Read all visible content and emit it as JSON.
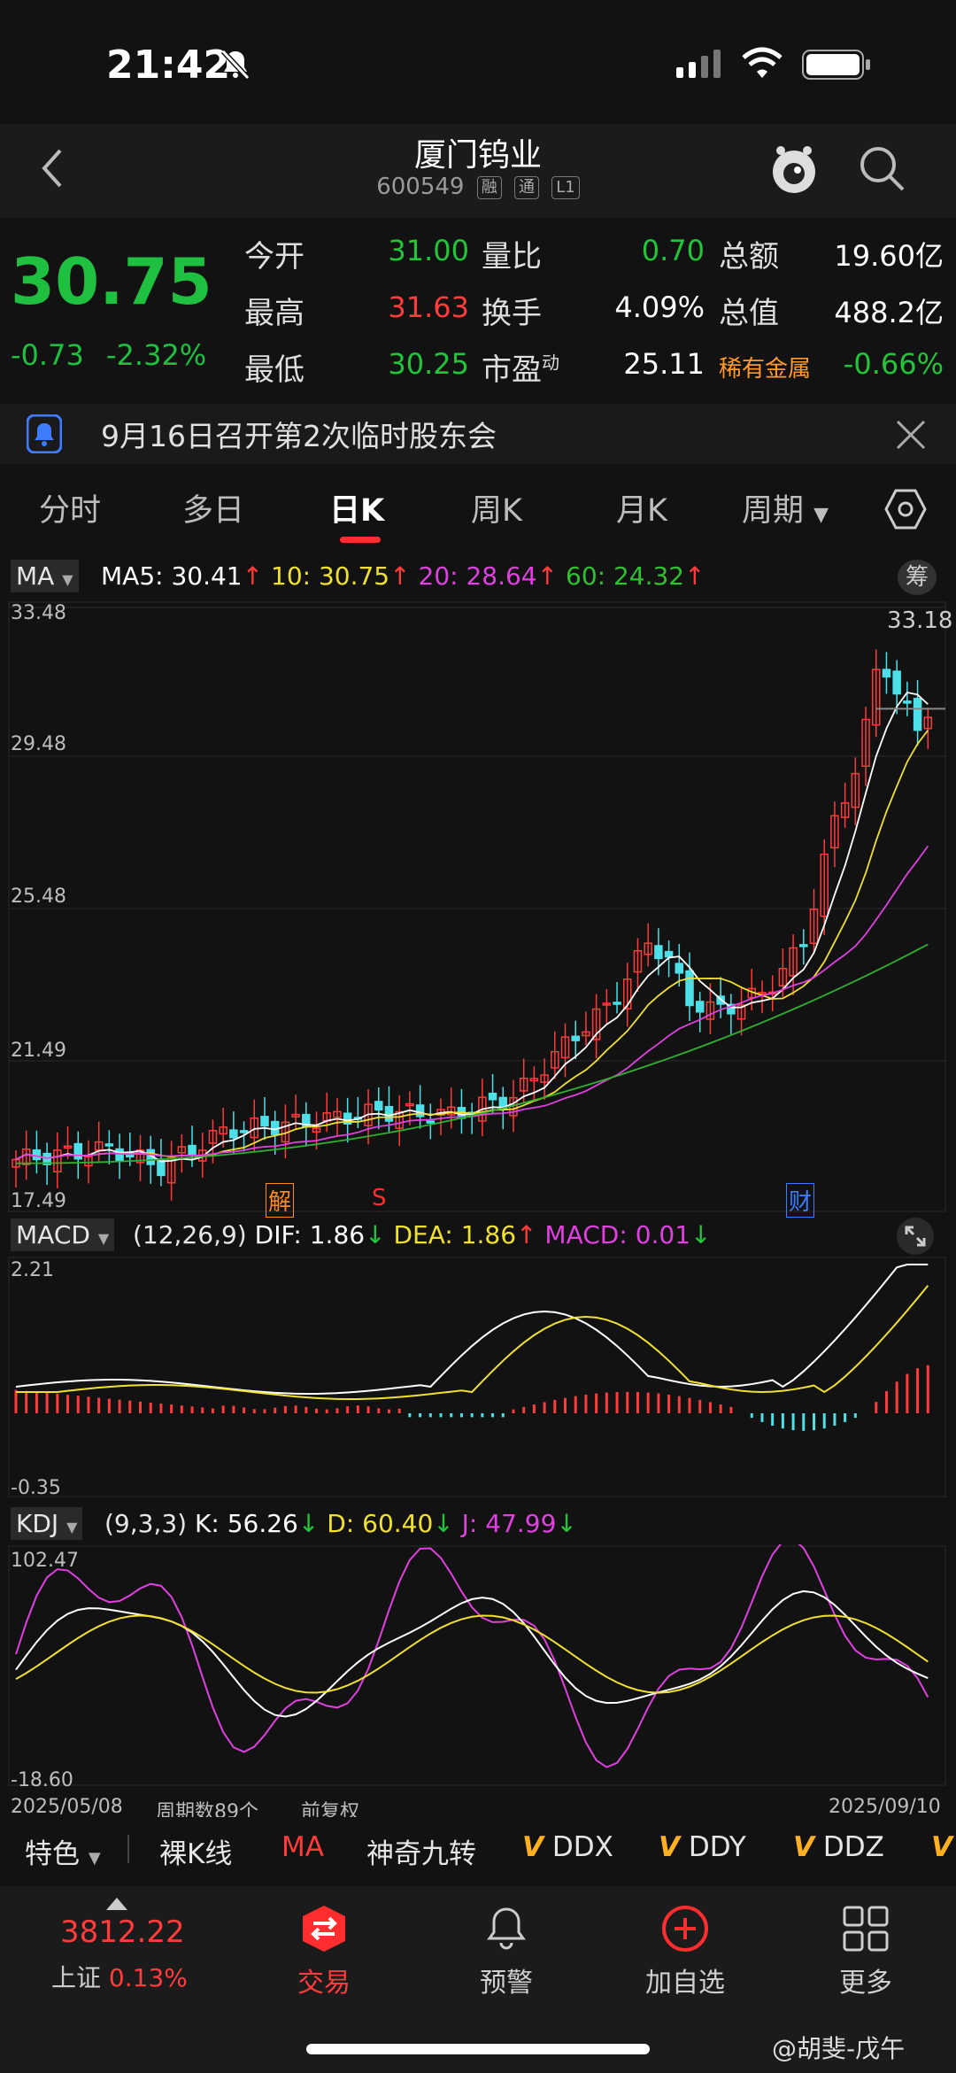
{
  "status": {
    "time": "21:42"
  },
  "header": {
    "title": "厦门钨业",
    "code": "600549",
    "tags": [
      "融",
      "通",
      "L1"
    ]
  },
  "quote": {
    "price": "30.75",
    "change": "-0.73",
    "change_pct": "-2.32%",
    "rows": [
      {
        "l1": "今开",
        "v1": "31.00",
        "l2": "量比",
        "v2": "0.70",
        "l3": "总额",
        "v3": "19.60亿"
      },
      {
        "l1": "最高",
        "v1": "31.63",
        "l2": "换手",
        "v2": "4.09%",
        "l3": "总值",
        "v3": "488.2亿"
      },
      {
        "l1": "最低",
        "v1": "30.25",
        "l2": "市盈",
        "l2sup": "动",
        "v2": "25.11",
        "l3": "稀有金属",
        "v3": "-0.66%"
      }
    ]
  },
  "notice": {
    "text": "9月16日召开第2次临时股东会"
  },
  "tabs": [
    "分时",
    "多日",
    "日K",
    "周K",
    "月K",
    "周期"
  ],
  "ma_legend": {
    "label": "MA",
    "ma5": "MA5: 30.41",
    "ma10": "10: 30.75",
    "ma20": "20: 28.64",
    "ma60": "60: 24.32",
    "chip": "筹"
  },
  "kline": {
    "y_labels": [
      "33.48",
      "29.48",
      "25.48",
      "21.49",
      "17.49"
    ],
    "high_marker": "33.18",
    "markers": [
      "解",
      "S",
      "财"
    ]
  },
  "macd_legend": {
    "label": "MACD",
    "params": "(12,26,9)",
    "dif": "DIF: 1.86",
    "dea": "DEA: 1.86",
    "macd": "MACD: 0.01",
    "y_top": "2.21",
    "y_bot": "-0.35"
  },
  "kdj_legend": {
    "label": "KDJ",
    "params": "(9,3,3)",
    "k": "K: 56.26",
    "d": "D: 60.40",
    "j": "J: 47.99",
    "y_top": "102.47",
    "y_bot": "-18.60"
  },
  "xaxis": {
    "start": "2025/05/08",
    "period": "周期数89个",
    "adj": "前复权",
    "end": "2025/09/10"
  },
  "bottom_tools": [
    "特色",
    "裸K线",
    "MA",
    "神奇九转",
    "DDX",
    "DDY",
    "DDZ"
  ],
  "footer": {
    "index_value": "3812.22",
    "index_name": "上证",
    "index_pct": "0.13%",
    "items": [
      "交易",
      "预警",
      "加自选",
      "更多"
    ]
  },
  "watermark": "@胡斐-戊午",
  "colors": {
    "up": "#ff3b3b",
    "down": "#22c43a",
    "ma5": "#ffffff",
    "ma10": "#f0e030",
    "ma20": "#e040e0",
    "ma60": "#30b030",
    "bear_candle": "#4de0e8"
  }
}
